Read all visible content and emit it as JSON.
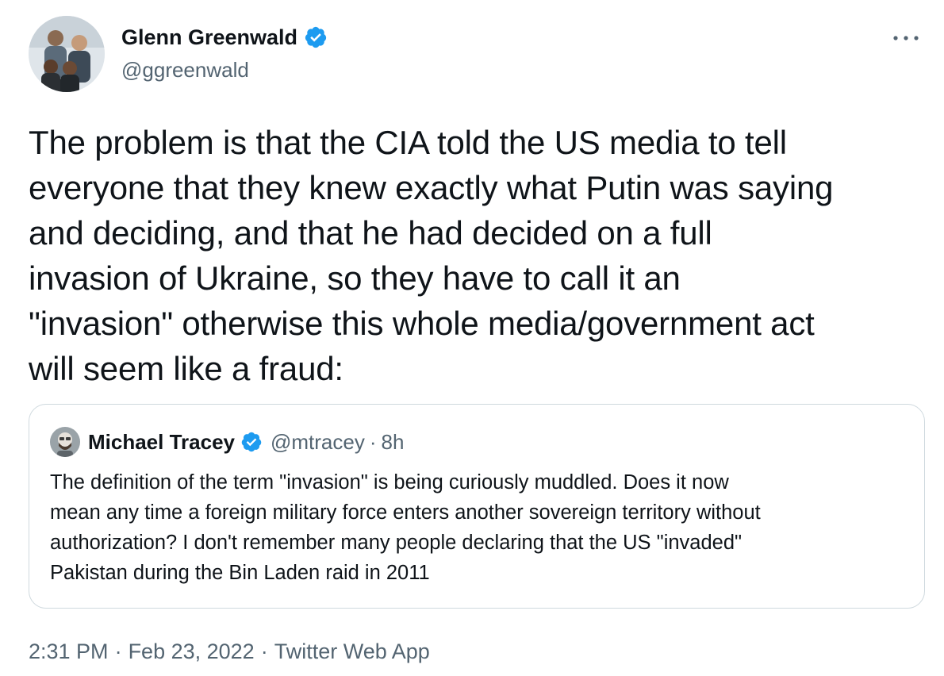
{
  "author": {
    "name": "Glenn Greenwald",
    "handle": "@ggreenwald",
    "verified": true
  },
  "tweet": {
    "text": "The problem is that the CIA told the US media to tell\neveryone that they knew exactly what Putin was saying\nand deciding, and that he had decided on a full\ninvasion of Ukraine, so they have to call it an\n\"invasion\" otherwise this whole media/government act\nwill seem like a fraud:"
  },
  "quote": {
    "name": "Michael Tracey",
    "handle": "@mtracey",
    "separator": "·",
    "time": "8h",
    "verified": true,
    "text": "The definition of the term \"invasion\" is being curiously muddled. Does it now\nmean any time a foreign military force enters another sovereign territory without\nauthorization? I don't remember many people declaring that the US \"invaded\"\nPakistan during the Bin Laden raid in 2011"
  },
  "meta": {
    "time": "2:31 PM",
    "separator": "·",
    "date": "Feb 23, 2022",
    "source": "Twitter Web App"
  },
  "colors": {
    "verified": "#1d9bf0",
    "secondary_text": "#536471",
    "border": "#cfd9de",
    "text": "#0f1419"
  },
  "icons": {
    "verified": "verified-badge-icon",
    "more": "more-options-icon"
  }
}
